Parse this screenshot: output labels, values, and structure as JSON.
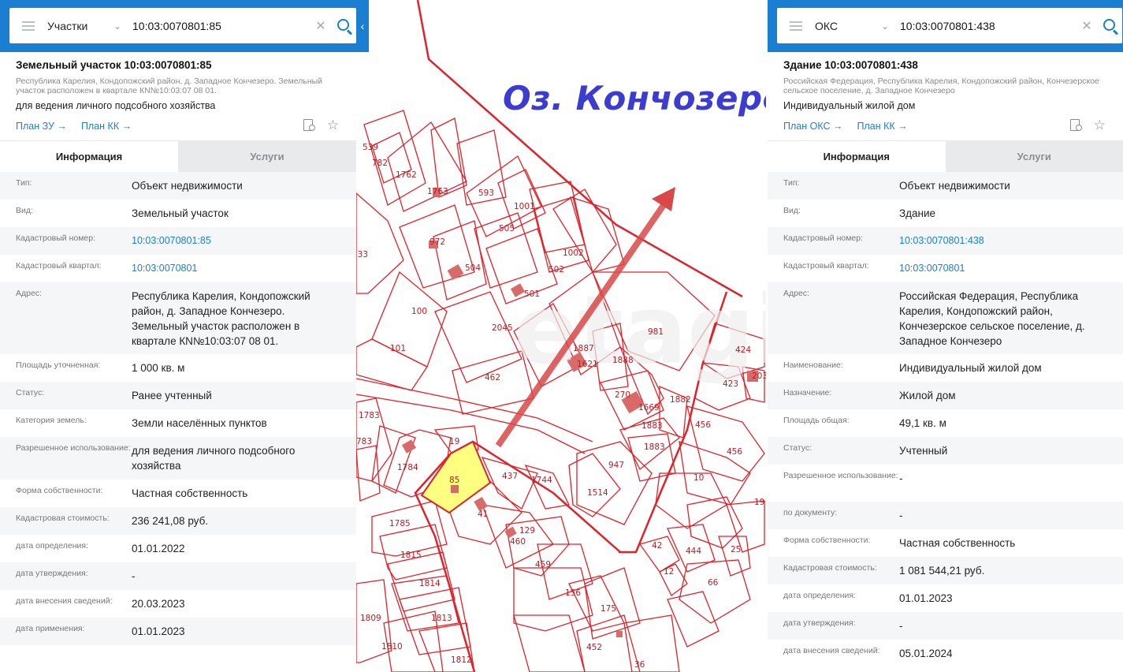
{
  "map": {
    "lake_label": "Оз. Кончозеро",
    "parcel_labels": [
      "539",
      "782",
      "1762",
      "1763",
      "593",
      "1001",
      "972",
      "505",
      "233",
      "504",
      "1002",
      "502",
      "501",
      "100",
      "2045",
      "981",
      "101",
      "1887",
      "1621",
      "1888",
      "462",
      "424",
      "423",
      "203",
      "270",
      "1669",
      "1882",
      "1783",
      "1883",
      "456",
      "783",
      "19",
      "1883",
      "456",
      "1784",
      "437",
      "1744",
      "947",
      "85",
      "10",
      "41",
      "1514",
      "129",
      "460",
      "1785",
      "42",
      "444",
      "25",
      "1815",
      "459",
      "12",
      "66",
      "1814",
      "156",
      "175",
      "1813",
      "1809",
      "452",
      "1810",
      "1812",
      "36",
      "19"
    ],
    "highlight_color": "#ffff80",
    "line_color": "#e0222a",
    "arrow_color": "#d94848",
    "lake_label_color": "#3c3cd0"
  },
  "left": {
    "search": {
      "type": "Участки",
      "query": "10:03:0070801:85"
    },
    "title": "Земельный участок 10:03:0070801:85",
    "address": "Республика Карелия, Кондопожский район, д. Западное Кончезеро. Земельный участок расположен в квартале КN№10:03:07 08 01.",
    "purpose": "для ведения личного подсобного хозяйства",
    "plan1": "План ЗУ →",
    "plan2": "План КК →",
    "tab_info": "Информация",
    "tab_services": "Услуги",
    "rows": [
      {
        "label": "Тип:",
        "value": "Объект недвижимости"
      },
      {
        "label": "Вид:",
        "value": "Земельный участок"
      },
      {
        "label": "Кадастровый номер:",
        "value": "10:03:0070801:85"
      },
      {
        "label": "Кадастровый квартал:",
        "value": "10:03:0070801"
      },
      {
        "label": "Адрес:",
        "value": "Республика Карелия, Кондопожский район, д. Западное Кончезеро. Земельный участок расположен в квартале КN№10:03:07 08 01."
      },
      {
        "label": "Площадь уточненная:",
        "value": "1 000 кв. м"
      },
      {
        "label": "Статус:",
        "value": "Ранее учтенный"
      },
      {
        "label": "Категория земель:",
        "value": "Земли населённых пунктов"
      },
      {
        "label": "Разрешенное использование:",
        "value": "для ведения личного подсобного хозяйства"
      },
      {
        "label": "Форма собственности:",
        "value": "Частная собственность"
      },
      {
        "label": "Кадастровая стоимость:",
        "value": "236 241,08 руб."
      },
      {
        "label": "дата определения:",
        "value": "01.01.2022"
      },
      {
        "label": "дата утверждения:",
        "value": "-"
      },
      {
        "label": "дата внесения сведений:",
        "value": "20.03.2023"
      },
      {
        "label": "дата применения:",
        "value": "01.01.2023"
      }
    ]
  },
  "right": {
    "search": {
      "type": "ОКС",
      "query": "10:03:0070801:438"
    },
    "title": "Здание 10:03:0070801:438",
    "address": "Российская Федерация, Республика Карелия, Кондопожский район, Кончезерское сельское поселение, д. Западное Кончезеро",
    "purpose": "Индивидуальный жилой дом",
    "plan1": "План ОКС →",
    "plan2": "План КК →",
    "tab_info": "Информация",
    "tab_services": "Услуги",
    "rows": [
      {
        "label": "Тип:",
        "value": "Объект недвижимости"
      },
      {
        "label": "Вид:",
        "value": "Здание"
      },
      {
        "label": "Кадастровый номер:",
        "value": "10:03:0070801:438"
      },
      {
        "label": "Кадастровый квартал:",
        "value": "10:03:0070801"
      },
      {
        "label": "Адрес:",
        "value": "Российская Федерация, Республика Карелия, Кондопожский район, Кончезерское сельское поселение, д. Западное Кончезеро"
      },
      {
        "label": "Наименование:",
        "value": "Индивидуальный жилой дом"
      },
      {
        "label": "Назначение:",
        "value": "Жилой дом"
      },
      {
        "label": "Площадь общая:",
        "value": "49,1 кв. м"
      },
      {
        "label": "Статус:",
        "value": "Учтенный"
      },
      {
        "label": "Разрешенное использование:",
        "value": "-"
      },
      {
        "label": "по документу:",
        "value": "-"
      },
      {
        "label": "Форма собственности:",
        "value": "Частная собственность"
      },
      {
        "label": "Кадастровая стоимость:",
        "value": "1 081 544,21 руб."
      },
      {
        "label": "дата определения:",
        "value": "01.01.2023"
      },
      {
        "label": "дата утверждения:",
        "value": "-"
      },
      {
        "label": "дата внесения сведений:",
        "value": "05.01.2024"
      }
    ]
  }
}
